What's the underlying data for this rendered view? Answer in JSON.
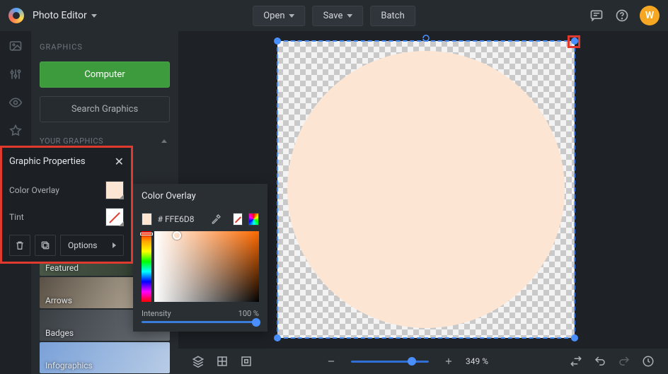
{
  "app": {
    "title": "Photo Editor"
  },
  "topbar": {
    "open": "Open",
    "save": "Save",
    "batch": "Batch"
  },
  "avatar": {
    "initial": "W"
  },
  "sidebar": {
    "section": "GRAPHICS",
    "computer_btn": "Computer",
    "search_btn": "Search Graphics",
    "sub_section": "YOUR GRAPHICS",
    "thumbs": [
      {
        "label": "Featured"
      },
      {
        "label": "Arrows"
      },
      {
        "label": "Badges"
      },
      {
        "label": "Infographics"
      }
    ]
  },
  "props": {
    "title": "Graphic Properties",
    "color_overlay": "Color Overlay",
    "tint": "Tint",
    "options": "Options"
  },
  "colorpanel": {
    "title": "Color Overlay",
    "hex": "# FFE6D8",
    "intensity_label": "Intensity",
    "intensity_value": "100 %"
  },
  "bottombar": {
    "zoom": "349 %"
  }
}
